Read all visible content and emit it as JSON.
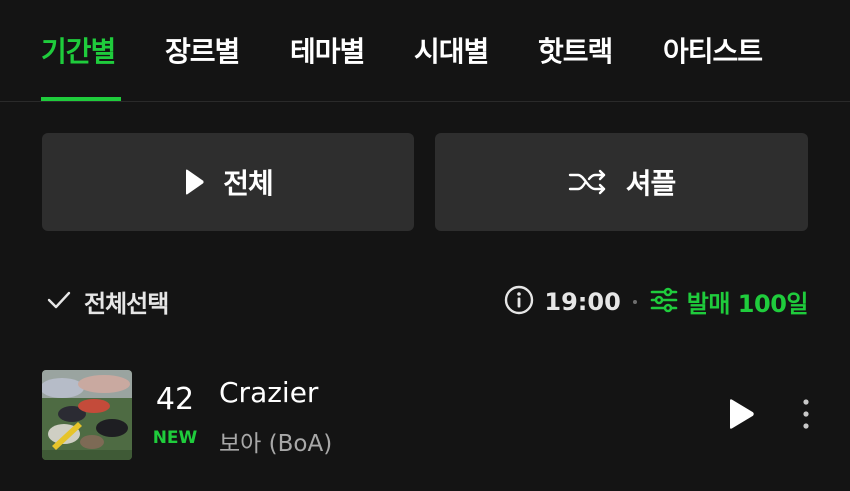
{
  "tabs": [
    {
      "label": "기간별",
      "active": true
    },
    {
      "label": "장르별",
      "active": false
    },
    {
      "label": "테마별",
      "active": false
    },
    {
      "label": "시대별",
      "active": false
    },
    {
      "label": "핫트랙",
      "active": false
    },
    {
      "label": "아티스트",
      "active": false
    }
  ],
  "actions": {
    "play_all_label": "전체",
    "shuffle_label": "셔플"
  },
  "toolbar": {
    "select_all_label": "전체선택",
    "update_time": "19:00",
    "filter_label": "발매 100일"
  },
  "songs": [
    {
      "rank": "42",
      "badge": "NEW",
      "title": "Crazier",
      "artist": "보아 (BoA)"
    }
  ],
  "colors": {
    "accent": "#1fcc3c",
    "background": "#141414",
    "button_bg": "#2e2e2e",
    "secondary_text": "#a8a8a8"
  },
  "icons": {
    "play": "play-icon",
    "shuffle": "shuffle-icon",
    "check": "check-icon",
    "info": "info-icon",
    "filter": "sliders-icon",
    "more": "more-vertical-icon"
  }
}
